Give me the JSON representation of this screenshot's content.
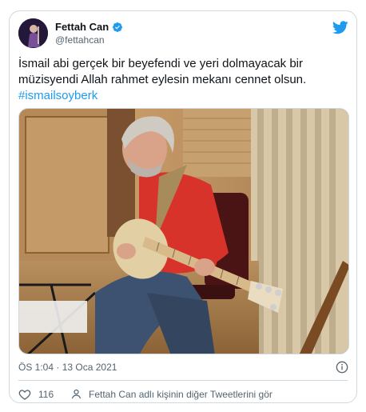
{
  "author": {
    "name": "Fettah Can",
    "handle": "@fettahcan"
  },
  "tweet": {
    "text_main": "İsmail abi  gerçek bir beyefendi ve yeri dolmayacak bir müzisyendi Allah rahmet eylesin mekanı cennet olsun.",
    "hashtag": "#ismailsoyberk",
    "timestamp": "ÖS 1:04 · 13 Oca 2021",
    "like_count": "116",
    "other_tweets_label": "Fettah Can adlı kişinin diğer Tweetlerini gör"
  },
  "colors": {
    "accent": "#1d9bf0",
    "text": "#0f1419",
    "muted": "#536471",
    "border": "#cfd9de"
  },
  "icons": {
    "verified": "verified-badge-icon",
    "brand": "twitter-bird-icon",
    "info": "info-icon",
    "like": "heart-icon",
    "profile": "person-icon"
  }
}
